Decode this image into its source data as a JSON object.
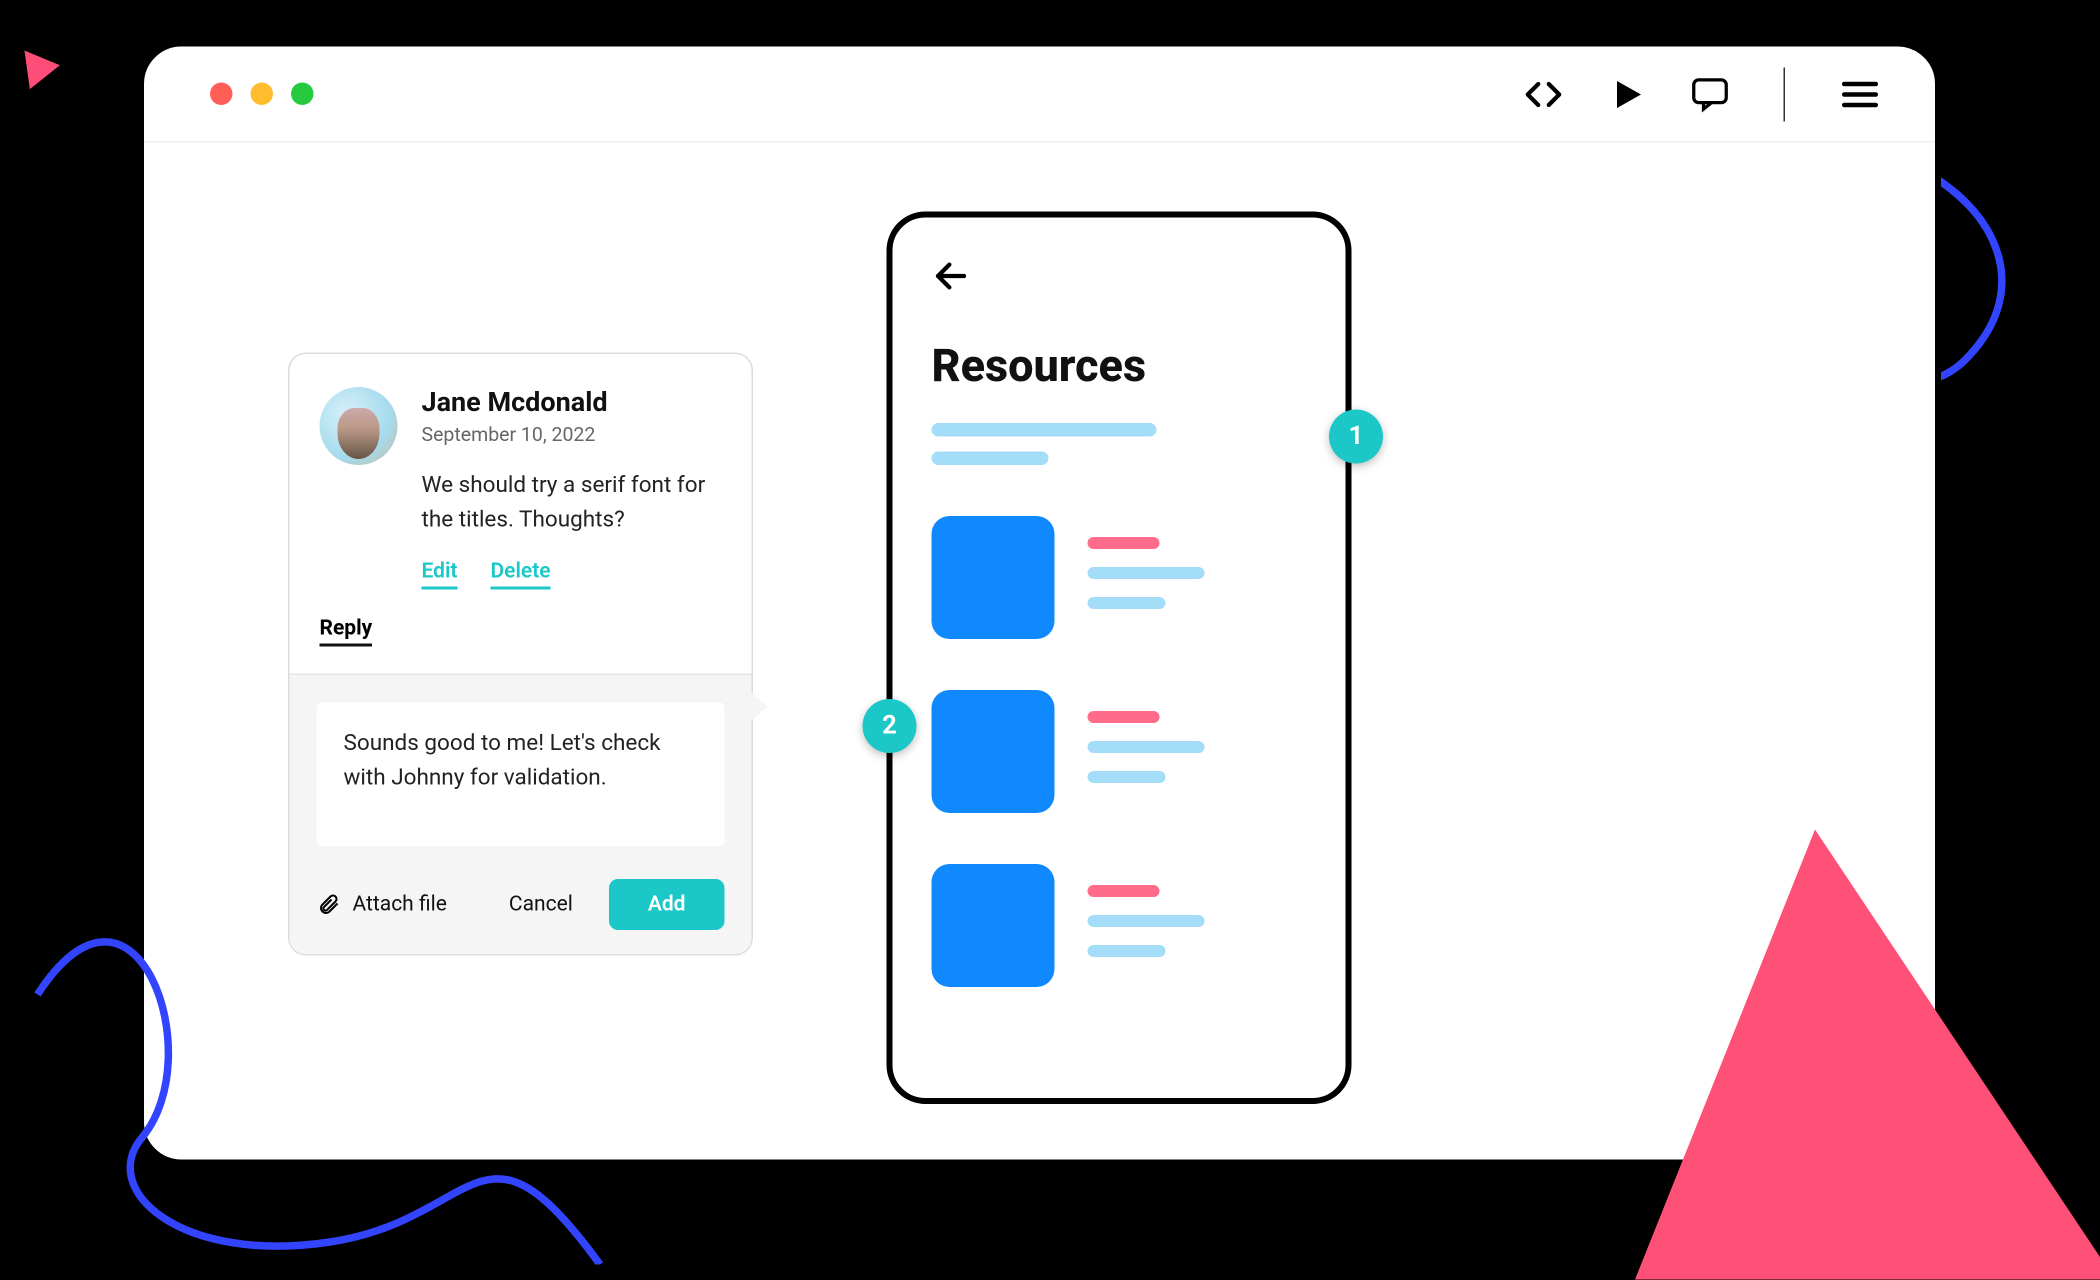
{
  "toolbar": {
    "icons": [
      "code",
      "play",
      "comment",
      "menu"
    ]
  },
  "comment": {
    "author": "Jane Mcdonald",
    "date": "September 10, 2022",
    "message": "We should try a serif font for the titles. Thoughts?",
    "edit_label": "Edit",
    "delete_label": "Delete",
    "reply_label": "Reply",
    "reply_text": "Sounds good to me! Let's check with Johnny for validation.",
    "attach_label": "Attach file",
    "cancel_label": "Cancel",
    "add_label": "Add"
  },
  "phone": {
    "title": "Resources"
  },
  "pins": {
    "p1": "1",
    "p2": "2"
  }
}
